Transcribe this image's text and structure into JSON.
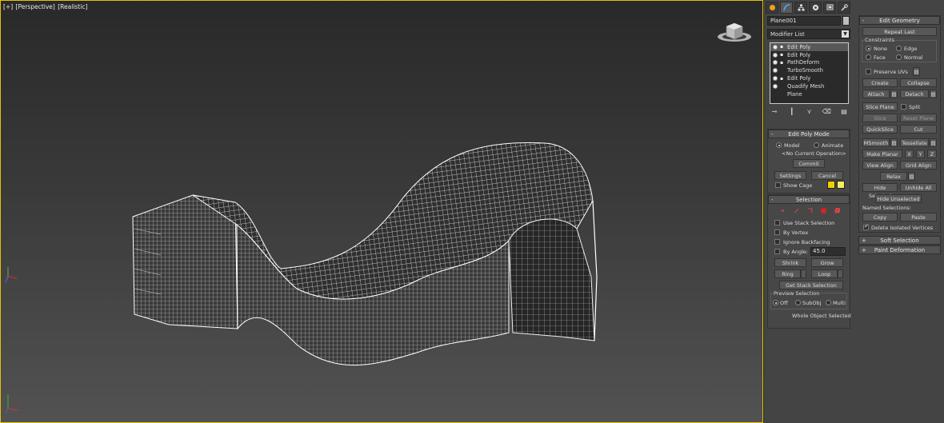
{
  "viewport": {
    "label_plus": "[+]",
    "label_view": "[Perspective]",
    "label_shading": "[Realistic]"
  },
  "panel": {
    "tabs": [
      "create-icon",
      "modify-icon",
      "hierarchy-icon",
      "motion-icon",
      "display-icon",
      "utilities-icon"
    ],
    "object_name": "Plane001",
    "modifier_list": "Modifier List",
    "stack": [
      {
        "label": "Edit Poly",
        "bulb": true,
        "plus": true,
        "selected": true
      },
      {
        "label": "Edit Poly",
        "bulb": true,
        "plus": true,
        "selected": false
      },
      {
        "label": "PathDeform",
        "bulb": true,
        "plus": true,
        "selected": false
      },
      {
        "label": "TurboSmooth",
        "bulb": true,
        "plus": false,
        "selected": false
      },
      {
        "label": "Edit Poly",
        "bulb": true,
        "plus": true,
        "selected": false
      },
      {
        "label": "Quadify Mesh",
        "bulb": true,
        "plus": false,
        "selected": false
      },
      {
        "label": "Plane",
        "bulb": false,
        "plus": false,
        "selected": false
      }
    ],
    "edit_poly_mode": {
      "title": "Edit Poly Mode",
      "model": "Model",
      "animate": "Animate",
      "operation": "<No Current Operation>",
      "commit": "Commit",
      "settings": "Settings",
      "cancel": "Cancel",
      "show_cage": "Show Cage",
      "cage_color_1": "#f0d000",
      "cage_color_2": "#f0ee60"
    },
    "selection": {
      "title": "Selection",
      "use_stack": "Use Stack Selection",
      "by_vertex": "By Vertex",
      "ignore_backfacing": "Ignore Backfacing",
      "by_angle": "By Angle:",
      "angle_value": "45.0",
      "shrink": "Shrink",
      "grow": "Grow",
      "ring": "Ring",
      "loop": "Loop",
      "get_stack": "Get Stack Selection",
      "preview_title": "Preview Selection",
      "off": "Off",
      "subobj": "SubObj",
      "multi": "Multi",
      "status": "Whole Object Selected"
    },
    "edit_geometry": {
      "title": "Edit Geometry",
      "repeat_last": "Repeat Last",
      "constraints": "Constraints",
      "none": "None",
      "edge": "Edge",
      "face": "Face",
      "normal": "Normal",
      "preserve_uvs": "Preserve UVs",
      "create": "Create",
      "collapse": "Collapse",
      "attach": "Attach",
      "detach": "Detach",
      "slice_plane": "Slice Plane",
      "split": "Split",
      "slice": "Slice",
      "reset_plane": "Reset Plane",
      "quickslice": "QuickSlice",
      "cut": "Cut",
      "msmooth": "MSmooth",
      "tessellate": "Tessellate",
      "make_planar": "Make Planar",
      "x": "X",
      "y": "Y",
      "z": "Z",
      "view_align": "View Align",
      "grid_align": "Grid Align",
      "relax": "Relax",
      "hide_selected": "Hide Selected",
      "unhide_all": "Unhide All",
      "hide_unselected": "Hide Unselected",
      "named_selections": "Named Selections:",
      "copy": "Copy",
      "paste": "Paste",
      "delete_isolated": "Delete Isolated Vertices"
    },
    "soft_selection": "Soft Selection",
    "paint_deformation": "Paint Deformation"
  }
}
